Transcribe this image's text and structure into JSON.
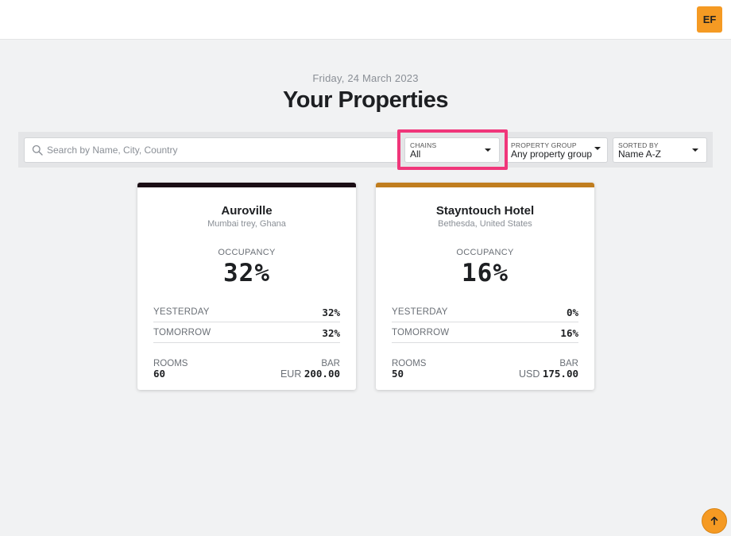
{
  "header": {
    "avatar_initials": "EF"
  },
  "page": {
    "date": "Friday, 24 March 2023",
    "title": "Your Properties"
  },
  "filters": {
    "search_placeholder": "Search by Name, City, Country",
    "chains": {
      "label": "CHAINS",
      "value": "All"
    },
    "property_group": {
      "label": "PROPERTY GROUP",
      "value": "Any property group"
    },
    "sorted_by": {
      "label": "SORTED BY",
      "value": "Name A-Z"
    }
  },
  "properties": [
    {
      "name": "Auroville",
      "location": "Mumbai trey, Ghana",
      "accent_color": "#1a0d14",
      "occupancy_label": "OCCUPANCY",
      "occupancy": "32%",
      "yesterday_label": "YESTERDAY",
      "yesterday": "32%",
      "tomorrow_label": "TOMORROW",
      "tomorrow": "32%",
      "rooms_label": "ROOMS",
      "rooms": "60",
      "bar_label": "BAR",
      "bar_currency": "EUR",
      "bar_amount": "200.00"
    },
    {
      "name": "Stayntouch Hotel",
      "location": "Bethesda, United States",
      "accent_color": "#c07d1e",
      "occupancy_label": "OCCUPANCY",
      "occupancy": "16%",
      "yesterday_label": "YESTERDAY",
      "yesterday": "0%",
      "tomorrow_label": "TOMORROW",
      "tomorrow": "16%",
      "rooms_label": "ROOMS",
      "rooms": "50",
      "bar_label": "BAR",
      "bar_currency": "USD",
      "bar_amount": "175.00"
    }
  ],
  "colors": {
    "brand_orange": "#f59a23",
    "highlight_pink": "#f0367a"
  },
  "scroll_top_icon": "arrow-up-icon"
}
